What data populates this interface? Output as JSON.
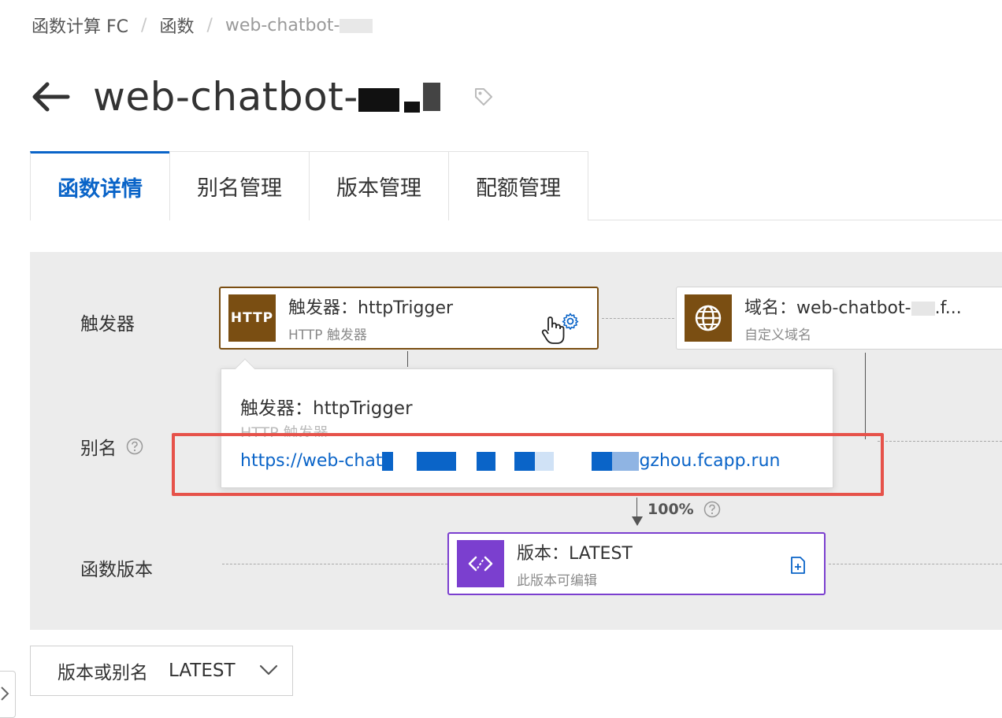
{
  "breadcrumb": {
    "items": [
      "函数计算 FC",
      "函数",
      "web-chatbot-"
    ],
    "separator": "/"
  },
  "header": {
    "title": "web-chatbot-"
  },
  "tabs": [
    {
      "label": "函数详情",
      "active": true
    },
    {
      "label": "别名管理",
      "active": false
    },
    {
      "label": "版本管理",
      "active": false
    },
    {
      "label": "配额管理",
      "active": false
    }
  ],
  "diagram": {
    "row_labels": {
      "trigger": "触发器",
      "alias": "别名",
      "version": "函数版本"
    },
    "trigger_node": {
      "icon_text": "HTTP",
      "title": "触发器：httpTrigger",
      "subtitle": "HTTP 触发器"
    },
    "domain_node": {
      "title": "域名：web-chatbot-",
      "title_suffix": ".f...",
      "subtitle": "自定义域名"
    },
    "version_node": {
      "title": "版本：LATEST",
      "subtitle": "此版本可编辑"
    },
    "weight": "100%"
  },
  "popover": {
    "title": "触发器：httpTrigger",
    "subtitle": "HTTP 触发器",
    "url_start": "https://web-chat",
    "url_end": "gzhou.fcapp.run"
  },
  "version_select": {
    "label": "版本或别名",
    "value": "LATEST"
  },
  "colors": {
    "accent": "#0a64c8",
    "trigger_brown": "#7a4e12",
    "version_purple": "#7b3fcf",
    "highlight_red": "#e6524a"
  }
}
